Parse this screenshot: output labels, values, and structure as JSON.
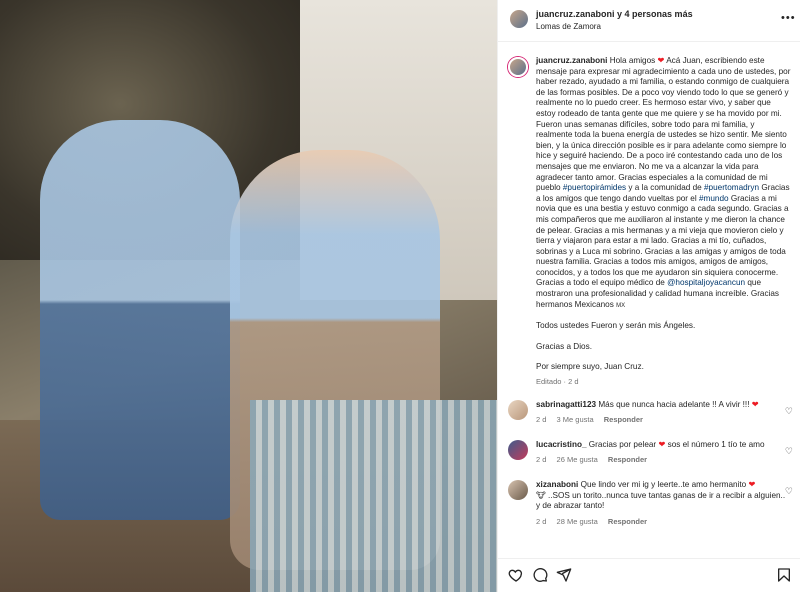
{
  "post": {
    "author": "juancruz.zanaboni",
    "coauthors_text": "y 4 personas más",
    "location": "Lomas de Zamora",
    "more_icon": "ellipsis-icon"
  },
  "caption": {
    "user": "juancruz.zanaboni",
    "intro": "Hola amigos",
    "body1": "Acá Juan, escribiendo este mensaje para expresar mi agradecimiento a cada uno de ustedes, por haber rezado, ayudado a mi familia, o estando conmigo de cualquiera de las formas posibles. De a poco voy viendo todo lo que se generó y realmente no lo puedo creer. Es hermoso estar vivo, y saber que estoy rodeado de tanta gente que me quiere y se ha movido por mi. Fueron unas semanas difíciles, sobre todo para mi familia, y realmente toda la buena energía de ustedes se hizo sentir. Me siento bien, y la única dirección posible es ir para adelante como siempre lo hice y seguiré haciendo. De a poco iré contestando cada uno de los mensajes que me enviaron. No me va a alcanzar la vida para agradecer tanto amor. Gracias especiales a la comunidad de mi pueblo",
    "tag1": "#puertopirámides",
    "body2": "y a la comunidad de",
    "tag2": "#puertomadryn",
    "body3": "Gracias a los amigos que tengo dando vueltas por el",
    "tag3": "#mundo",
    "body4": "Gracias a mi novia que es una bestia y estuvo conmigo a cada segundo. Gracias a mis compañeros que me auxiliaron al instante y me dieron la chance de pelear. Gracias a mis hermanas y a mi vieja que movieron cielo y tierra y viajaron para estar a mi lado. Gracias a mi tío, cuñados, sobrinas y a Luca mi sobrino. Gracias a las amigas y amigos de toda nuestra familia. Gracias a todos mis amigos, amigos de amigos, conocidos, y a todos los que me ayudaron sin siquiera conocerme. Gracias a todo el equipo médico de",
    "tag4": "@hospitaljoyacancun",
    "body5": "que mostraron una profesionalidad y calidad humana increíble. Gracias hermanos Mexicanos",
    "flag": "MX",
    "p2": "Todos ustedes Fueron y serán mis Ángeles.",
    "p3": "Gracias a Dios.",
    "p4": "Por siempre suyo, Juan Cruz.",
    "meta": "Editado · 2 d"
  },
  "comments": [
    {
      "user": "sabrinagatti123",
      "text": "Más que nunca hacia adelante !! A vivir !!!",
      "time": "2 d",
      "likes": "3 Me gusta",
      "reply": "Responder",
      "heart_icon": "heart-outline-icon"
    },
    {
      "user": "lucacristino_",
      "text": "Gracias por pelear",
      "text2": "sos el número 1 tío te amo",
      "time": "2 d",
      "likes": "26 Me gusta",
      "reply": "Responder",
      "heart_icon": "heart-outline-icon"
    },
    {
      "user": "xizanaboni",
      "text": "Que lindo ver mi ig y leerte..te amo hermanito",
      "text2": "..SOS un torito..nunca tuve tantas ganas de ir a recibir a alguien.. y de abrazar tanto!",
      "time": "2 d",
      "likes": "28 Me gusta",
      "reply": "Responder",
      "heart_icon": "heart-outline-icon"
    }
  ],
  "actions": {
    "like_icon": "heart-icon",
    "comment_icon": "comment-icon",
    "share_icon": "send-icon",
    "save_icon": "bookmark-icon"
  },
  "colors": {
    "heart_red": "#ed1c24",
    "link_blue": "#00376b",
    "muted": "#737373"
  }
}
